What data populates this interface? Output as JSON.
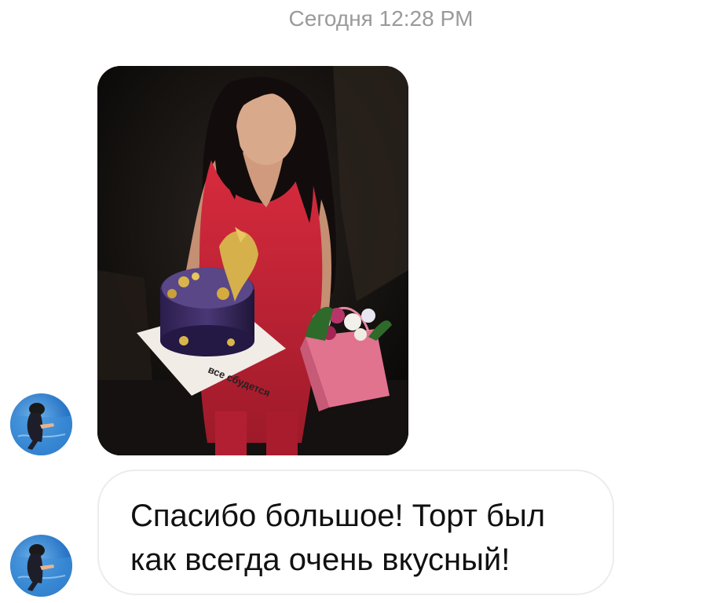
{
  "chat": {
    "timestamp": "Сегодня 12:28 PM",
    "photo_message": {
      "image_description_icon": "photo-attachment",
      "cake_text": "все сбудется"
    },
    "text_message": {
      "line1": "Спасибо большое! Торт был",
      "line2": "как всегда очень вкусный!"
    },
    "avatar_icon": "user-avatar-pool"
  }
}
